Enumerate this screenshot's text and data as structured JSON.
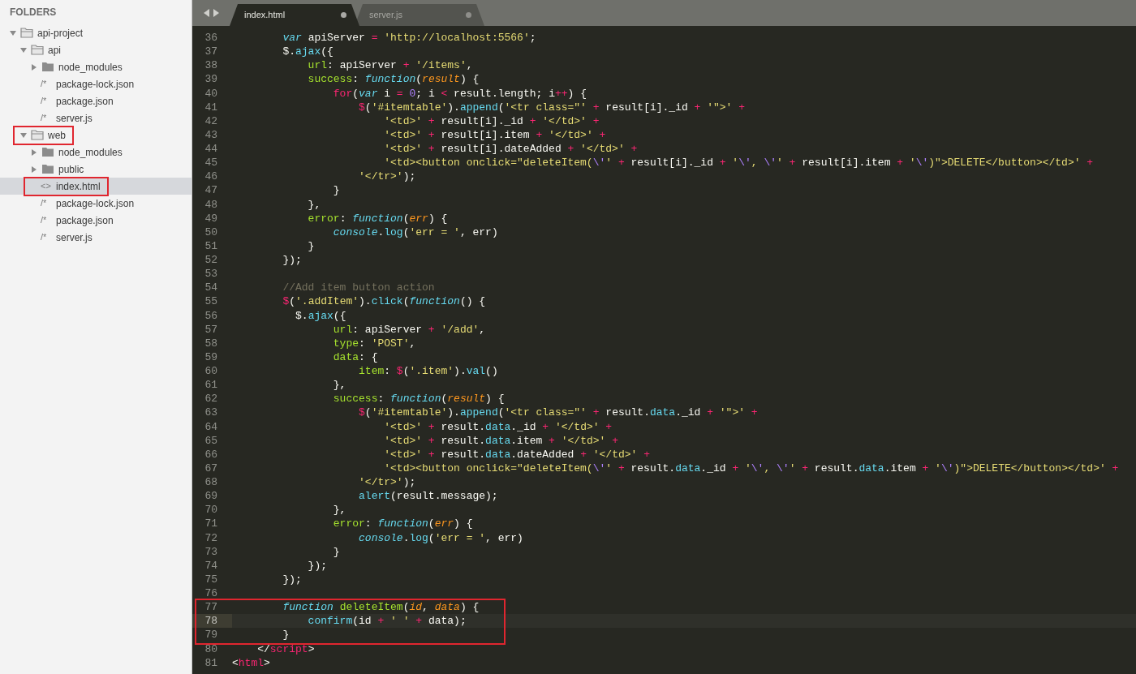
{
  "sidebar": {
    "header": "FOLDERS",
    "tree": [
      {
        "label": "api-project",
        "kind": "folder",
        "expanded": true,
        "selected": false,
        "annotated": false,
        "children": [
          {
            "label": "api",
            "kind": "folder",
            "expanded": true,
            "selected": false,
            "annotated": false,
            "children": [
              {
                "label": "node_modules",
                "kind": "folder",
                "expanded": false,
                "selected": false,
                "annotated": false
              },
              {
                "label": "package-lock.json",
                "kind": "file",
                "icon": "/*",
                "selected": false,
                "annotated": false
              },
              {
                "label": "package.json",
                "kind": "file",
                "icon": "/*",
                "selected": false,
                "annotated": false
              },
              {
                "label": "server.js",
                "kind": "file",
                "icon": "/*",
                "selected": false,
                "annotated": false
              }
            ]
          },
          {
            "label": "web",
            "kind": "folder",
            "expanded": true,
            "selected": false,
            "annotated": true,
            "children": [
              {
                "label": "node_modules",
                "kind": "folder",
                "expanded": false,
                "selected": false,
                "annotated": false
              },
              {
                "label": "public",
                "kind": "folder",
                "expanded": false,
                "selected": false,
                "annotated": false
              },
              {
                "label": "index.html",
                "kind": "file",
                "icon": "<>",
                "selected": true,
                "annotated": true
              },
              {
                "label": "package-lock.json",
                "kind": "file",
                "icon": "/*",
                "selected": false,
                "annotated": false
              },
              {
                "label": "package.json",
                "kind": "file",
                "icon": "/*",
                "selected": false,
                "annotated": false
              },
              {
                "label": "server.js",
                "kind": "file",
                "icon": "/*",
                "selected": false,
                "annotated": false
              }
            ]
          }
        ]
      }
    ]
  },
  "tabs": [
    {
      "label": "index.html",
      "selected": true,
      "modified": true
    },
    {
      "label": "server.js",
      "selected": false,
      "modified": true
    }
  ],
  "editor": {
    "lines": [
      {
        "number": "36",
        "current": false,
        "boxed": false,
        "tokens": [
          {
            "kind": "storage",
            "text": "        var"
          },
          {
            "kind": "plain",
            "text": " apiServer "
          },
          {
            "kind": "keyword",
            "text": "="
          },
          {
            "kind": "string",
            "text": " 'http://localhost:5566'"
          },
          {
            "kind": "plain",
            "text": ";"
          }
        ]
      },
      {
        "number": "37",
        "current": false,
        "boxed": false,
        "tokens": [
          {
            "kind": "plain",
            "text": "        $."
          },
          {
            "kind": "support",
            "text": "ajax"
          },
          {
            "kind": "plain",
            "text": "({"
          }
        ]
      },
      {
        "number": "38",
        "current": false,
        "boxed": false,
        "tokens": [
          {
            "kind": "entity",
            "text": "            url"
          },
          {
            "kind": "plain",
            "text": ": apiServer "
          },
          {
            "kind": "keyword",
            "text": "+"
          },
          {
            "kind": "string",
            "text": " '/items'"
          },
          {
            "kind": "plain",
            "text": ","
          }
        ]
      },
      {
        "number": "39",
        "current": false,
        "boxed": false,
        "tokens": [
          {
            "kind": "entity",
            "text": "            success"
          },
          {
            "kind": "plain",
            "text": ": "
          },
          {
            "kind": "storage",
            "text": "function"
          },
          {
            "kind": "plain",
            "text": "("
          },
          {
            "kind": "parameter",
            "text": "result"
          },
          {
            "kind": "plain",
            "text": ") {"
          }
        ]
      },
      {
        "number": "40",
        "current": false,
        "boxed": false,
        "tokens": [
          {
            "kind": "keyword",
            "text": "                for"
          },
          {
            "kind": "plain",
            "text": "("
          },
          {
            "kind": "storage",
            "text": "var"
          },
          {
            "kind": "plain",
            "text": " i "
          },
          {
            "kind": "keyword",
            "text": "="
          },
          {
            "kind": "constant",
            "text": " 0"
          },
          {
            "kind": "plain",
            "text": "; i "
          },
          {
            "kind": "keyword",
            "text": "<"
          },
          {
            "kind": "plain",
            "text": " result.length; i"
          },
          {
            "kind": "keyword",
            "text": "++"
          },
          {
            "kind": "plain",
            "text": ") {"
          }
        ]
      },
      {
        "number": "41",
        "current": false,
        "boxed": false,
        "tokens": [
          {
            "kind": "keyword",
            "text": "                    $"
          },
          {
            "kind": "plain",
            "text": "("
          },
          {
            "kind": "string",
            "text": "'#itemtable'"
          },
          {
            "kind": "plain",
            "text": ")."
          },
          {
            "kind": "support",
            "text": "append"
          },
          {
            "kind": "plain",
            "text": "("
          },
          {
            "kind": "string",
            "text": "'<tr class=\"'"
          },
          {
            "kind": "keyword",
            "text": " +"
          },
          {
            "kind": "plain",
            "text": " result[i]._id "
          },
          {
            "kind": "keyword",
            "text": "+"
          },
          {
            "kind": "string",
            "text": " '\">'"
          },
          {
            "kind": "keyword",
            "text": " +"
          }
        ]
      },
      {
        "number": "42",
        "current": false,
        "boxed": false,
        "tokens": [
          {
            "kind": "string",
            "text": "                        '<td>'"
          },
          {
            "kind": "keyword",
            "text": " +"
          },
          {
            "kind": "plain",
            "text": " result[i]._id "
          },
          {
            "kind": "keyword",
            "text": "+"
          },
          {
            "kind": "string",
            "text": " '</td>'"
          },
          {
            "kind": "keyword",
            "text": " +"
          }
        ]
      },
      {
        "number": "43",
        "current": false,
        "boxed": false,
        "tokens": [
          {
            "kind": "string",
            "text": "                        '<td>'"
          },
          {
            "kind": "keyword",
            "text": " +"
          },
          {
            "kind": "plain",
            "text": " result[i].item "
          },
          {
            "kind": "keyword",
            "text": "+"
          },
          {
            "kind": "string",
            "text": " '</td>'"
          },
          {
            "kind": "keyword",
            "text": " +"
          }
        ]
      },
      {
        "number": "44",
        "current": false,
        "boxed": false,
        "tokens": [
          {
            "kind": "string",
            "text": "                        '<td>'"
          },
          {
            "kind": "keyword",
            "text": " +"
          },
          {
            "kind": "plain",
            "text": " result[i].dateAdded "
          },
          {
            "kind": "keyword",
            "text": "+"
          },
          {
            "kind": "string",
            "text": " '</td>'"
          },
          {
            "kind": "keyword",
            "text": " +"
          }
        ]
      },
      {
        "number": "45",
        "current": false,
        "boxed": false,
        "tokens": [
          {
            "kind": "string",
            "text": "                        '<td><button onclick=\"deleteItem("
          },
          {
            "kind": "constant",
            "text": "\\'"
          },
          {
            "kind": "string",
            "text": "'"
          },
          {
            "kind": "keyword",
            "text": " +"
          },
          {
            "kind": "plain",
            "text": " result[i]._id "
          },
          {
            "kind": "keyword",
            "text": "+"
          },
          {
            "kind": "string",
            "text": " '"
          },
          {
            "kind": "constant",
            "text": "\\'"
          },
          {
            "kind": "string",
            "text": ", "
          },
          {
            "kind": "constant",
            "text": "\\'"
          },
          {
            "kind": "string",
            "text": "'"
          },
          {
            "kind": "keyword",
            "text": " +"
          },
          {
            "kind": "plain",
            "text": " result[i].item "
          },
          {
            "kind": "keyword",
            "text": "+"
          },
          {
            "kind": "string",
            "text": " '"
          },
          {
            "kind": "constant",
            "text": "\\'"
          },
          {
            "kind": "string",
            "text": ")\">DELETE</button></td>'"
          },
          {
            "kind": "keyword",
            "text": " +"
          }
        ]
      },
      {
        "number": "46",
        "current": false,
        "boxed": false,
        "tokens": [
          {
            "kind": "string",
            "text": "                    '</tr>'"
          },
          {
            "kind": "plain",
            "text": ");"
          }
        ]
      },
      {
        "number": "47",
        "current": false,
        "boxed": false,
        "tokens": [
          {
            "kind": "plain",
            "text": "                }"
          }
        ]
      },
      {
        "number": "48",
        "current": false,
        "boxed": false,
        "tokens": [
          {
            "kind": "plain",
            "text": "            },"
          }
        ]
      },
      {
        "number": "49",
        "current": false,
        "boxed": false,
        "tokens": [
          {
            "kind": "entity",
            "text": "            error"
          },
          {
            "kind": "plain",
            "text": ": "
          },
          {
            "kind": "storage",
            "text": "function"
          },
          {
            "kind": "plain",
            "text": "("
          },
          {
            "kind": "parameter",
            "text": "err"
          },
          {
            "kind": "plain",
            "text": ") {"
          }
        ]
      },
      {
        "number": "50",
        "current": false,
        "boxed": false,
        "tokens": [
          {
            "kind": "storage",
            "text": "                console"
          },
          {
            "kind": "plain",
            "text": "."
          },
          {
            "kind": "support",
            "text": "log"
          },
          {
            "kind": "plain",
            "text": "("
          },
          {
            "kind": "string",
            "text": "'err = '"
          },
          {
            "kind": "plain",
            "text": ", err)"
          }
        ]
      },
      {
        "number": "51",
        "current": false,
        "boxed": false,
        "tokens": [
          {
            "kind": "plain",
            "text": "            }"
          }
        ]
      },
      {
        "number": "52",
        "current": false,
        "boxed": false,
        "tokens": [
          {
            "kind": "plain",
            "text": "        });"
          }
        ]
      },
      {
        "number": "53",
        "current": false,
        "boxed": false
      },
      {
        "number": "54",
        "current": false,
        "boxed": false,
        "tokens": [
          {
            "kind": "comment",
            "text": "        //Add item button action"
          }
        ]
      },
      {
        "number": "55",
        "current": false,
        "boxed": false,
        "tokens": [
          {
            "kind": "keyword",
            "text": "        $"
          },
          {
            "kind": "plain",
            "text": "("
          },
          {
            "kind": "string",
            "text": "'.addItem'"
          },
          {
            "kind": "plain",
            "text": ")."
          },
          {
            "kind": "support",
            "text": "click"
          },
          {
            "kind": "plain",
            "text": "("
          },
          {
            "kind": "storage",
            "text": "function"
          },
          {
            "kind": "plain",
            "text": "() {"
          }
        ]
      },
      {
        "number": "56",
        "current": false,
        "boxed": false,
        "tokens": [
          {
            "kind": "plain",
            "text": "          $."
          },
          {
            "kind": "support",
            "text": "ajax"
          },
          {
            "kind": "plain",
            "text": "({"
          }
        ]
      },
      {
        "number": "57",
        "current": false,
        "boxed": false,
        "tokens": [
          {
            "kind": "entity",
            "text": "                url"
          },
          {
            "kind": "plain",
            "text": ": apiServer "
          },
          {
            "kind": "keyword",
            "text": "+"
          },
          {
            "kind": "string",
            "text": " '/add'"
          },
          {
            "kind": "plain",
            "text": ","
          }
        ]
      },
      {
        "number": "58",
        "current": false,
        "boxed": false,
        "tokens": [
          {
            "kind": "entity",
            "text": "                type"
          },
          {
            "kind": "plain",
            "text": ": "
          },
          {
            "kind": "string",
            "text": "'POST'"
          },
          {
            "kind": "plain",
            "text": ","
          }
        ]
      },
      {
        "number": "59",
        "current": false,
        "boxed": false,
        "tokens": [
          {
            "kind": "entity",
            "text": "                data"
          },
          {
            "kind": "plain",
            "text": ": {"
          }
        ]
      },
      {
        "number": "60",
        "current": false,
        "boxed": false,
        "tokens": [
          {
            "kind": "entity",
            "text": "                    item"
          },
          {
            "kind": "plain",
            "text": ": "
          },
          {
            "kind": "keyword",
            "text": "$"
          },
          {
            "kind": "plain",
            "text": "("
          },
          {
            "kind": "string",
            "text": "'.item'"
          },
          {
            "kind": "plain",
            "text": ")."
          },
          {
            "kind": "support",
            "text": "val"
          },
          {
            "kind": "plain",
            "text": "()"
          }
        ]
      },
      {
        "number": "61",
        "current": false,
        "boxed": false,
        "tokens": [
          {
            "kind": "plain",
            "text": "                },"
          }
        ]
      },
      {
        "number": "62",
        "current": false,
        "boxed": false,
        "tokens": [
          {
            "kind": "entity",
            "text": "                success"
          },
          {
            "kind": "plain",
            "text": ": "
          },
          {
            "kind": "storage",
            "text": "function"
          },
          {
            "kind": "plain",
            "text": "("
          },
          {
            "kind": "parameter",
            "text": "result"
          },
          {
            "kind": "plain",
            "text": ") {"
          }
        ]
      },
      {
        "number": "63",
        "current": false,
        "boxed": false,
        "tokens": [
          {
            "kind": "keyword",
            "text": "                    $"
          },
          {
            "kind": "plain",
            "text": "("
          },
          {
            "kind": "string",
            "text": "'#itemtable'"
          },
          {
            "kind": "plain",
            "text": ")."
          },
          {
            "kind": "support",
            "text": "append"
          },
          {
            "kind": "plain",
            "text": "("
          },
          {
            "kind": "string",
            "text": "'<tr class=\"'"
          },
          {
            "kind": "keyword",
            "text": " +"
          },
          {
            "kind": "plain",
            "text": " result."
          },
          {
            "kind": "support",
            "text": "data"
          },
          {
            "kind": "plain",
            "text": "._id "
          },
          {
            "kind": "keyword",
            "text": "+"
          },
          {
            "kind": "string",
            "text": " '\">'"
          },
          {
            "kind": "keyword",
            "text": " +"
          }
        ]
      },
      {
        "number": "64",
        "current": false,
        "boxed": false,
        "tokens": [
          {
            "kind": "string",
            "text": "                        '<td>'"
          },
          {
            "kind": "keyword",
            "text": " +"
          },
          {
            "kind": "plain",
            "text": " result."
          },
          {
            "kind": "support",
            "text": "data"
          },
          {
            "kind": "plain",
            "text": "._id "
          },
          {
            "kind": "keyword",
            "text": "+"
          },
          {
            "kind": "string",
            "text": " '</td>'"
          },
          {
            "kind": "keyword",
            "text": " +"
          }
        ]
      },
      {
        "number": "65",
        "current": false,
        "boxed": false,
        "tokens": [
          {
            "kind": "string",
            "text": "                        '<td>'"
          },
          {
            "kind": "keyword",
            "text": " +"
          },
          {
            "kind": "plain",
            "text": " result."
          },
          {
            "kind": "support",
            "text": "data"
          },
          {
            "kind": "plain",
            "text": ".item "
          },
          {
            "kind": "keyword",
            "text": "+"
          },
          {
            "kind": "string",
            "text": " '</td>'"
          },
          {
            "kind": "keyword",
            "text": " +"
          }
        ]
      },
      {
        "number": "66",
        "current": false,
        "boxed": false,
        "tokens": [
          {
            "kind": "string",
            "text": "                        '<td>'"
          },
          {
            "kind": "keyword",
            "text": " +"
          },
          {
            "kind": "plain",
            "text": " result."
          },
          {
            "kind": "support",
            "text": "data"
          },
          {
            "kind": "plain",
            "text": ".dateAdded "
          },
          {
            "kind": "keyword",
            "text": "+"
          },
          {
            "kind": "string",
            "text": " '</td>'"
          },
          {
            "kind": "keyword",
            "text": " +"
          }
        ]
      },
      {
        "number": "67",
        "current": false,
        "boxed": false,
        "tokens": [
          {
            "kind": "string",
            "text": "                        '<td><button onclick=\"deleteItem("
          },
          {
            "kind": "constant",
            "text": "\\'"
          },
          {
            "kind": "string",
            "text": "'"
          },
          {
            "kind": "keyword",
            "text": " +"
          },
          {
            "kind": "plain",
            "text": " result."
          },
          {
            "kind": "support",
            "text": "data"
          },
          {
            "kind": "plain",
            "text": "._id "
          },
          {
            "kind": "keyword",
            "text": "+"
          },
          {
            "kind": "string",
            "text": " '"
          },
          {
            "kind": "constant",
            "text": "\\'"
          },
          {
            "kind": "string",
            "text": ", "
          },
          {
            "kind": "constant",
            "text": "\\'"
          },
          {
            "kind": "string",
            "text": "'"
          },
          {
            "kind": "keyword",
            "text": " +"
          },
          {
            "kind": "plain",
            "text": " result."
          },
          {
            "kind": "support",
            "text": "data"
          },
          {
            "kind": "plain",
            "text": ".item "
          },
          {
            "kind": "keyword",
            "text": "+"
          },
          {
            "kind": "string",
            "text": " '"
          },
          {
            "kind": "constant",
            "text": "\\'"
          },
          {
            "kind": "string",
            "text": ")\">DELETE</button></td>'"
          },
          {
            "kind": "keyword",
            "text": " +"
          }
        ]
      },
      {
        "number": "68",
        "current": false,
        "boxed": false,
        "tokens": [
          {
            "kind": "string",
            "text": "                    '</tr>'"
          },
          {
            "kind": "plain",
            "text": ");"
          }
        ]
      },
      {
        "number": "69",
        "current": false,
        "boxed": false,
        "tokens": [
          {
            "kind": "support",
            "text": "                    alert"
          },
          {
            "kind": "plain",
            "text": "(result.message);"
          }
        ]
      },
      {
        "number": "70",
        "current": false,
        "boxed": false,
        "tokens": [
          {
            "kind": "plain",
            "text": "                },"
          }
        ]
      },
      {
        "number": "71",
        "current": false,
        "boxed": false,
        "tokens": [
          {
            "kind": "entity",
            "text": "                error"
          },
          {
            "kind": "plain",
            "text": ": "
          },
          {
            "kind": "storage",
            "text": "function"
          },
          {
            "kind": "plain",
            "text": "("
          },
          {
            "kind": "parameter",
            "text": "err"
          },
          {
            "kind": "plain",
            "text": ") {"
          }
        ]
      },
      {
        "number": "72",
        "current": false,
        "boxed": false,
        "tokens": [
          {
            "kind": "storage",
            "text": "                    console"
          },
          {
            "kind": "plain",
            "text": "."
          },
          {
            "kind": "support",
            "text": "log"
          },
          {
            "kind": "plain",
            "text": "("
          },
          {
            "kind": "string",
            "text": "'err = '"
          },
          {
            "kind": "plain",
            "text": ", err)"
          }
        ]
      },
      {
        "number": "73",
        "current": false,
        "boxed": false,
        "tokens": [
          {
            "kind": "plain",
            "text": "                }"
          }
        ]
      },
      {
        "number": "74",
        "current": false,
        "boxed": false,
        "tokens": [
          {
            "kind": "plain",
            "text": "            });"
          }
        ]
      },
      {
        "number": "75",
        "current": false,
        "boxed": false,
        "tokens": [
          {
            "kind": "plain",
            "text": "        });"
          }
        ]
      },
      {
        "number": "76",
        "current": false,
        "boxed": false
      },
      {
        "number": "77",
        "current": false,
        "boxed": true,
        "tokens": [
          {
            "kind": "storage",
            "text": "        function"
          },
          {
            "kind": "entity",
            "text": " deleteItem"
          },
          {
            "kind": "plain",
            "text": "("
          },
          {
            "kind": "parameter",
            "text": "id"
          },
          {
            "kind": "plain",
            "text": ", "
          },
          {
            "kind": "parameter",
            "text": "data"
          },
          {
            "kind": "plain",
            "text": ") {"
          }
        ]
      },
      {
        "number": "78",
        "current": true,
        "boxed": true,
        "tokens": [
          {
            "kind": "support",
            "text": "            confirm"
          },
          {
            "kind": "plain",
            "text": "(id "
          },
          {
            "kind": "keyword",
            "text": "+"
          },
          {
            "kind": "string",
            "text": " ' '"
          },
          {
            "kind": "keyword",
            "text": " +"
          },
          {
            "kind": "plain",
            "text": " data);"
          }
        ]
      },
      {
        "number": "79",
        "current": false,
        "boxed": true,
        "tokens": [
          {
            "kind": "plain",
            "text": "        }"
          }
        ]
      },
      {
        "number": "80",
        "current": false,
        "boxed": false,
        "tokens": [
          {
            "kind": "plain",
            "text": "    </"
          },
          {
            "kind": "tag",
            "text": "script"
          },
          {
            "kind": "plain",
            "text": ">"
          }
        ]
      },
      {
        "number": "81",
        "current": false,
        "boxed": false,
        "tokens": [
          {
            "kind": "plain",
            "text": "<"
          },
          {
            "kind": "tag",
            "text": "html"
          },
          {
            "kind": "plain",
            "text": ">"
          }
        ]
      }
    ]
  }
}
